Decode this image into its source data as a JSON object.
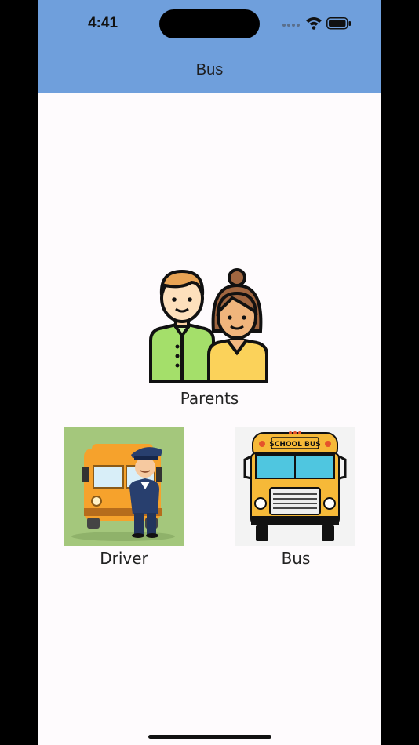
{
  "status_bar": {
    "time": "4:41"
  },
  "nav": {
    "title": "Bus"
  },
  "tiles": {
    "parents": {
      "label": "Parents"
    },
    "driver": {
      "label": "Driver"
    },
    "bus": {
      "label": "Bus",
      "sign": "SCHOOL BUS"
    }
  },
  "colors": {
    "header": "#6f9fdc",
    "background": "#fefbfd",
    "bus_yellow": "#f6b938"
  }
}
